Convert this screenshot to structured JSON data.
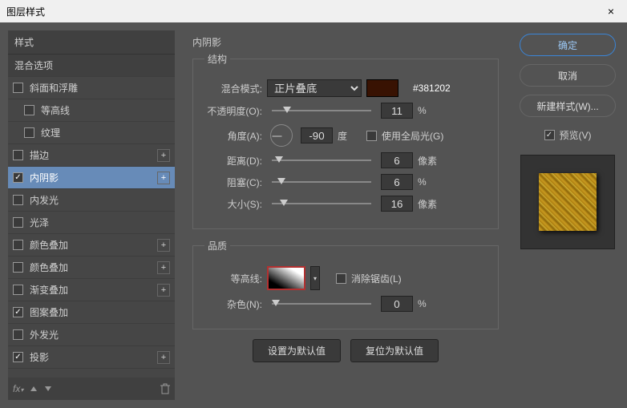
{
  "window": {
    "title": "图层样式",
    "close": "×"
  },
  "left": {
    "header": "样式",
    "blend": "混合选项",
    "items": [
      {
        "label": "斜面和浮雕",
        "checked": false,
        "plus": false,
        "indent": 0
      },
      {
        "label": "等高线",
        "checked": false,
        "plus": false,
        "indent": 1
      },
      {
        "label": "纹理",
        "checked": false,
        "plus": false,
        "indent": 1
      },
      {
        "label": "描边",
        "checked": false,
        "plus": true,
        "indent": 0
      },
      {
        "label": "内阴影",
        "checked": true,
        "plus": true,
        "indent": 0,
        "selected": true
      },
      {
        "label": "内发光",
        "checked": false,
        "plus": false,
        "indent": 0
      },
      {
        "label": "光泽",
        "checked": false,
        "plus": false,
        "indent": 0
      },
      {
        "label": "颜色叠加",
        "checked": false,
        "plus": true,
        "indent": 0
      },
      {
        "label": "颜色叠加",
        "checked": false,
        "plus": true,
        "indent": 0
      },
      {
        "label": "渐变叠加",
        "checked": false,
        "plus": true,
        "indent": 0
      },
      {
        "label": "图案叠加",
        "checked": true,
        "plus": false,
        "indent": 0
      },
      {
        "label": "外发光",
        "checked": false,
        "plus": false,
        "indent": 0
      },
      {
        "label": "投影",
        "checked": true,
        "plus": true,
        "indent": 0
      }
    ],
    "footer": {
      "fx": "fx",
      "trash": "trash"
    }
  },
  "mid": {
    "title": "内阴影",
    "structure": {
      "legend": "结构",
      "blend_mode_label": "混合模式:",
      "blend_mode_value": "正片叠底",
      "color": "#381202",
      "hex_label": "#381202",
      "opacity_label": "不透明度(O):",
      "opacity_value": "11",
      "opacity_unit": "%",
      "angle_label": "角度(A):",
      "angle_value": "-90",
      "angle_unit": "度",
      "global_light_label": "使用全局光(G)",
      "distance_label": "距离(D):",
      "distance_value": "6",
      "distance_unit": "像素",
      "choke_label": "阻塞(C):",
      "choke_value": "6",
      "choke_unit": "%",
      "size_label": "大小(S):",
      "size_value": "16",
      "size_unit": "像素"
    },
    "quality": {
      "legend": "品质",
      "contour_label": "等高线:",
      "antialias_label": "消除锯齿(L)",
      "noise_label": "杂色(N):",
      "noise_value": "0",
      "noise_unit": "%"
    },
    "buttons": {
      "default": "设置为默认值",
      "reset": "复位为默认值"
    }
  },
  "right": {
    "ok": "确定",
    "cancel": "取消",
    "new_style": "新建样式(W)...",
    "preview": "预览(V)"
  }
}
